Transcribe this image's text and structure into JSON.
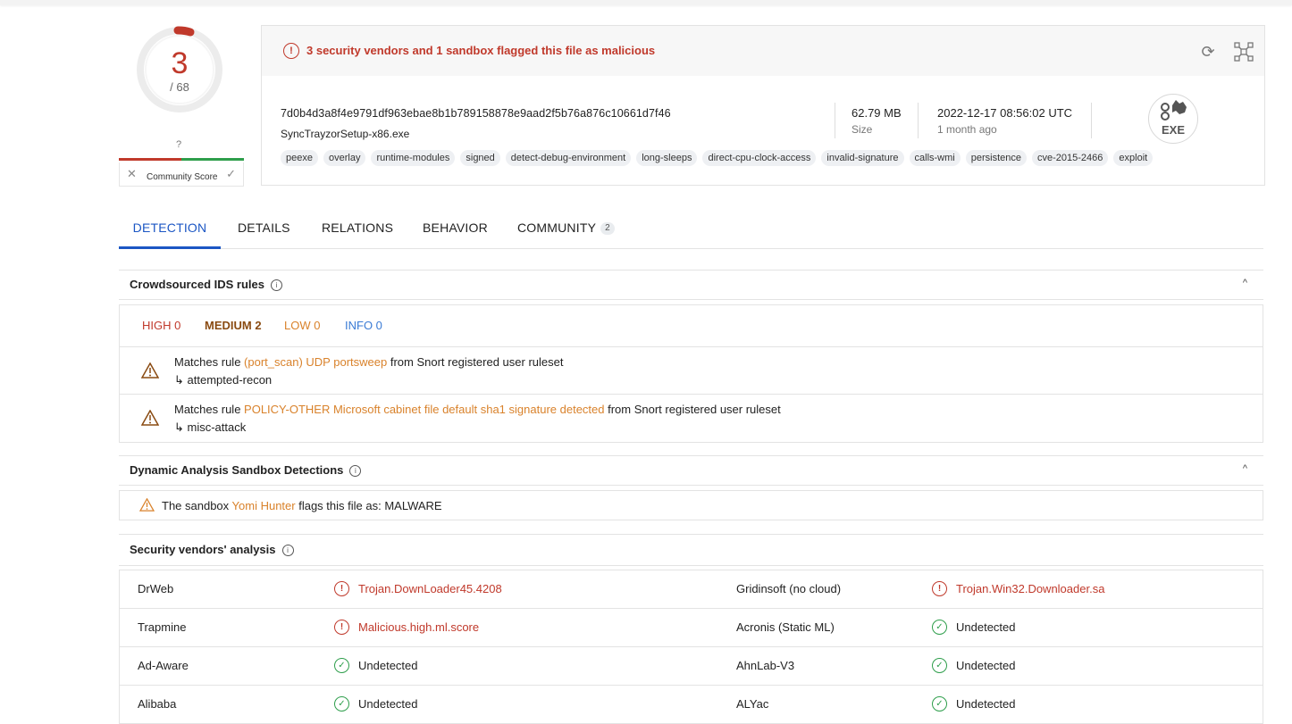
{
  "score": {
    "detections": "3",
    "total": "/ 68",
    "community_unknown": "?",
    "community_label": "Community Score"
  },
  "summary": {
    "alert": "3 security vendors and 1 sandbox flagged this file as malicious",
    "hash": "7d0b4d3a8f4e9791df963ebae8b1b789158878e9aad2f5b76a876c10661d7f46",
    "filename": "SyncTrayzorSetup-x86.exe",
    "size_value": "62.79 MB",
    "size_label": "Size",
    "date_value": "2022-12-17 08:56:02 UTC",
    "date_label": "1 month ago",
    "file_type": "EXE",
    "tags": [
      "peexe",
      "overlay",
      "runtime-modules",
      "signed",
      "detect-debug-environment",
      "long-sleeps",
      "direct-cpu-clock-access",
      "invalid-signature",
      "calls-wmi",
      "persistence",
      "cve-2015-2466",
      "exploit"
    ]
  },
  "tabs": [
    {
      "label": "DETECTION"
    },
    {
      "label": "DETAILS"
    },
    {
      "label": "RELATIONS"
    },
    {
      "label": "BEHAVIOR"
    },
    {
      "label": "COMMUNITY",
      "count": "2"
    }
  ],
  "ids": {
    "title": "Crowdsourced IDS rules",
    "high": "HIGH 0",
    "medium": "MEDIUM 2",
    "low": "LOW 0",
    "info": "INFO 0",
    "rules": [
      {
        "prefix": "Matches rule ",
        "rule": "(port_scan) UDP portsweep",
        "suffix": " from Snort registered user ruleset",
        "category": "↳ attempted-recon"
      },
      {
        "prefix": "Matches rule ",
        "rule": "POLICY-OTHER Microsoft cabinet file default sha1 signature detected",
        "suffix": " from Snort registered user ruleset",
        "category": "↳ misc-attack"
      }
    ]
  },
  "sandbox": {
    "title": "Dynamic Analysis Sandbox Detections",
    "prefix": "The sandbox ",
    "name": "Yomi Hunter",
    "suffix": " flags this file as: MALWARE"
  },
  "vendors": {
    "title": "Security vendors' analysis",
    "rows": [
      {
        "left": {
          "name": "DrWeb",
          "result": "Trojan.DownLoader45.4208",
          "status": "malicious"
        },
        "right": {
          "name": "Gridinsoft (no cloud)",
          "result": "Trojan.Win32.Downloader.sa",
          "status": "malicious"
        }
      },
      {
        "left": {
          "name": "Trapmine",
          "result": "Malicious.high.ml.score",
          "status": "malicious"
        },
        "right": {
          "name": "Acronis (Static ML)",
          "result": "Undetected",
          "status": "undetected"
        }
      },
      {
        "left": {
          "name": "Ad-Aware",
          "result": "Undetected",
          "status": "undetected"
        },
        "right": {
          "name": "AhnLab-V3",
          "result": "Undetected",
          "status": "undetected"
        }
      },
      {
        "left": {
          "name": "Alibaba",
          "result": "Undetected",
          "status": "undetected"
        },
        "right": {
          "name": "ALYac",
          "result": "Undetected",
          "status": "undetected"
        }
      }
    ]
  },
  "colors": {
    "malicious": "#c0392b",
    "clean": "#2e9e4b",
    "accent": "#1b56c4",
    "medium": "#8a4b12",
    "low": "#d9822b",
    "info": "#3a7bd5"
  }
}
